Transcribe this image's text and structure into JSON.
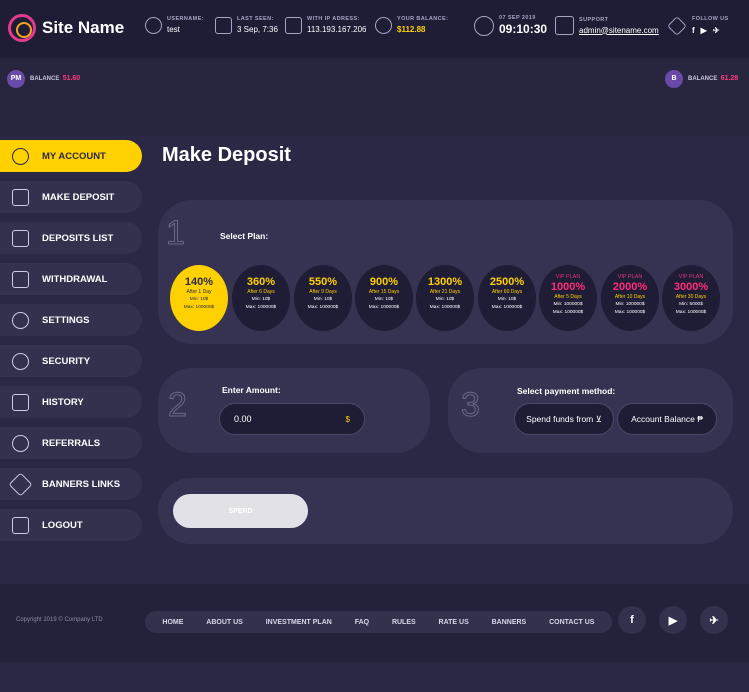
{
  "site": {
    "name": "Site Name"
  },
  "header": {
    "username": {
      "label": "Username:",
      "value": "test"
    },
    "last_seen": {
      "label": "Last seen:",
      "value": "3 Sep, 7:36"
    },
    "ip": {
      "label": "With IP adress:",
      "value": "113.193.167.206"
    },
    "balance": {
      "label": "Your balance:",
      "value": "$112.88"
    },
    "date": {
      "label": "07 SEP 2019",
      "value": "09:10:30"
    },
    "support": {
      "label": "Support",
      "value": "admin@sitename.com"
    },
    "follow": {
      "label": "Follow us",
      "icons": [
        "f",
        "▶",
        "✈"
      ]
    }
  },
  "balances": {
    "left": {
      "coin": "PM",
      "label": "BALANCE",
      "value": "51.60"
    },
    "right": {
      "coin": "B",
      "label": "BALANCE",
      "value": "61.28"
    }
  },
  "sidebar": {
    "items": [
      {
        "label": "My Account",
        "icon": "user-icon",
        "active": true
      },
      {
        "label": "Make Deposit",
        "icon": "chart-icon"
      },
      {
        "label": "Deposits List",
        "icon": "money-icon"
      },
      {
        "label": "Withdrawal",
        "icon": "wallet-icon"
      },
      {
        "label": "Settings",
        "icon": "gear-icon"
      },
      {
        "label": "Security",
        "icon": "shield-icon"
      },
      {
        "label": "History",
        "icon": "calendar-icon"
      },
      {
        "label": "Referrals",
        "icon": "people-icon"
      },
      {
        "label": "Banners Links",
        "icon": "link-icon"
      },
      {
        "label": "Logout",
        "icon": "logout-icon"
      }
    ]
  },
  "main": {
    "title": "Make Deposit",
    "step1": {
      "num": "1",
      "label": "Select Plan:"
    },
    "plans": [
      {
        "vip": "",
        "pct": "140%",
        "after": "After 1 Day",
        "min": "Min: 10$",
        "max": "Max: 100000$"
      },
      {
        "vip": "",
        "pct": "360%",
        "after": "After 6 Days",
        "min": "Min: 10$",
        "max": "Max: 100000$"
      },
      {
        "vip": "",
        "pct": "550%",
        "after": "After 9 Days",
        "min": "Min: 10$",
        "max": "Max: 100000$"
      },
      {
        "vip": "",
        "pct": "900%",
        "after": "After 15 Days",
        "min": "Min: 10$",
        "max": "Max: 100000$"
      },
      {
        "vip": "",
        "pct": "1300%",
        "after": "After 21 Days",
        "min": "Min: 10$",
        "max": "Max: 100000$"
      },
      {
        "vip": "",
        "pct": "2500%",
        "after": "After 60 Days",
        "min": "Min: 10$",
        "max": "Max: 100000$"
      },
      {
        "vip": "VIP PLAN",
        "pct": "1000%",
        "after": "After 5 Days",
        "min": "Min: 100000$",
        "max": "Max: 100000$"
      },
      {
        "vip": "VIP PLAN",
        "pct": "2000%",
        "after": "After 10 Days",
        "min": "Min: 100000$",
        "max": "Max: 100000$"
      },
      {
        "vip": "VIP PLAN",
        "pct": "3000%",
        "after": "After 30 Days",
        "min": "Min: 5000$",
        "max": "Max: 100000$"
      }
    ],
    "step2": {
      "num": "2",
      "label": "Enter Amount:",
      "value": "0.00",
      "currency": "$"
    },
    "step3": {
      "num": "3",
      "label": "Select payment method:",
      "options": [
        "Spend funds from ⊻",
        "Account Balance ₱"
      ]
    },
    "spend_label": "Spend"
  },
  "footer": {
    "copyright": "Copyright 2019 © Company LTD",
    "nav": [
      "Home",
      "About Us",
      "Investment Plan",
      "FAQ",
      "Rules",
      "Rate Us",
      "Banners",
      "Contact Us"
    ],
    "social": [
      "f",
      "▶",
      "✈"
    ]
  }
}
